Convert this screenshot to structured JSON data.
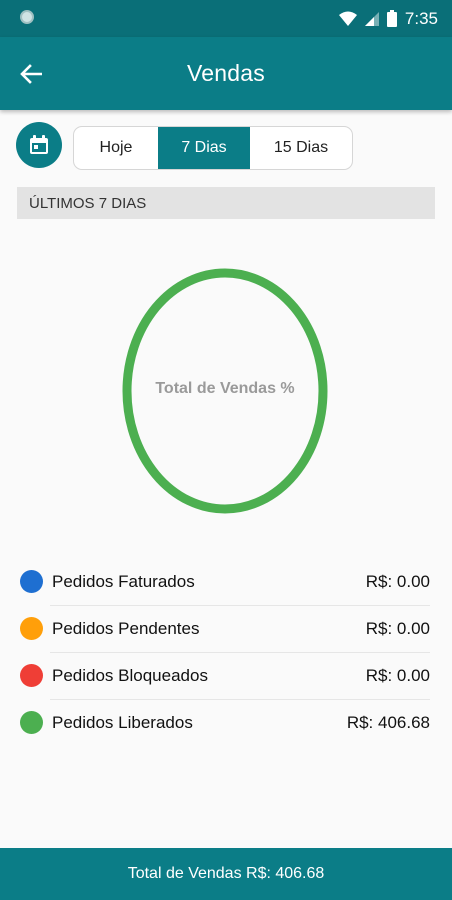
{
  "status_bar": {
    "time": "7:35",
    "icons": [
      "notification-dot-icon",
      "wifi-icon",
      "signal-icon",
      "battery-icon"
    ]
  },
  "app_bar": {
    "title": "Vendas",
    "back_icon": "arrow-left-icon"
  },
  "filter": {
    "calendar_icon": "calendar-icon",
    "options": [
      {
        "label": "Hoje",
        "active": false
      },
      {
        "label": "7 Dias",
        "active": true
      },
      {
        "label": "15 Dias",
        "active": false
      }
    ]
  },
  "section": {
    "title": "ÚLTIMOS 7 DIAS"
  },
  "chart_data": {
    "type": "pie",
    "title": "Total de Vendas %",
    "categories": [
      "Pedidos Faturados",
      "Pedidos Pendentes",
      "Pedidos Bloqueados",
      "Pedidos Liberados"
    ],
    "values": [
      0.0,
      0.0,
      0.0,
      406.68
    ],
    "colors": [
      "#1e6fd1",
      "#ff9f0a",
      "#ef3e36",
      "#4caf50"
    ]
  },
  "legend": [
    {
      "label": "Pedidos Faturados",
      "value": "R$: 0.00",
      "color": "#1e6fd1"
    },
    {
      "label": "Pedidos Pendentes",
      "value": "R$: 0.00",
      "color": "#ff9f0a"
    },
    {
      "label": "Pedidos Bloqueados",
      "value": "R$: 0.00",
      "color": "#ef3e36"
    },
    {
      "label": "Pedidos Liberados",
      "value": "R$: 406.68",
      "color": "#4caf50"
    }
  ],
  "footer": {
    "text": "Total de Vendas R$: 406.68"
  },
  "colors": {
    "primary": "#0b7d87",
    "status_bar": "#0a6f78",
    "section_bg": "#e3e3e3"
  }
}
